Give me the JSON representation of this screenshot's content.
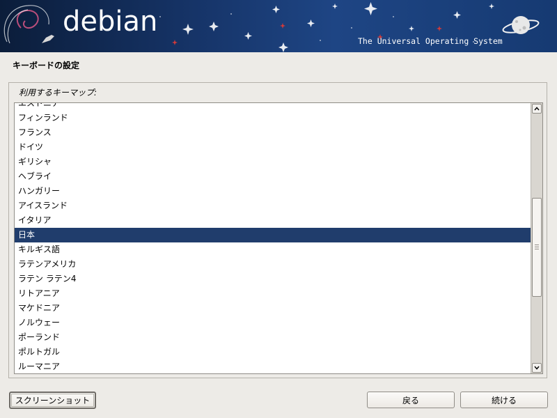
{
  "banner": {
    "logo": "debian",
    "tagline": "The Universal Operating System"
  },
  "page": {
    "title": "キーボードの設定",
    "list_label": "利用するキーマップ:"
  },
  "keymaps": [
    "エストニア",
    "フィンランド",
    "フランス",
    "ドイツ",
    "ギリシャ",
    "ヘブライ",
    "ハンガリー",
    "アイスランド",
    "イタリア",
    "日本",
    "キルギス語",
    "ラテンアメリカ",
    "ラテン ラテン4",
    "リトアニア",
    "マケドニア",
    "ノルウェー",
    "ポーランド",
    "ポルトガル",
    "ルーマニア"
  ],
  "selected_keymap": "日本",
  "buttons": {
    "screenshot": "スクリーンショット",
    "back": "戻る",
    "continue": "続ける"
  },
  "colors": {
    "selection": "#203d6c",
    "background": "#edebe7"
  },
  "icons": {
    "scroll_up": "chevron-up-icon",
    "scroll_down": "chevron-down-icon"
  }
}
